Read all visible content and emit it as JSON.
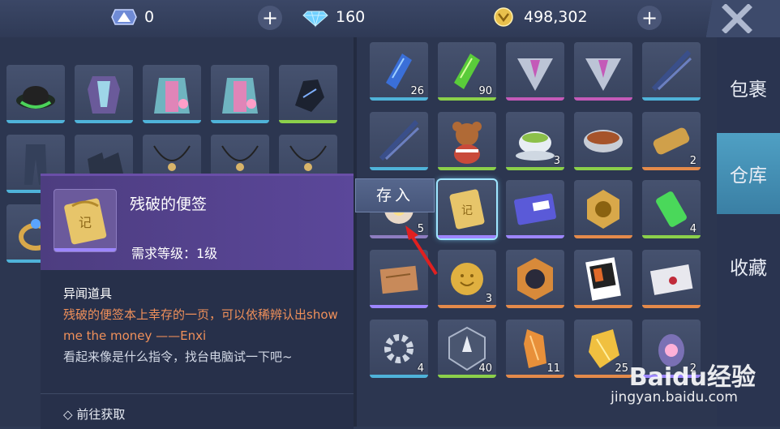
{
  "topbar": {
    "currency1": {
      "value": "0",
      "icon": "triangle-token-icon"
    },
    "currency2": {
      "value": "160",
      "icon": "diamond-icon"
    },
    "currency3": {
      "value": "498,302",
      "icon": "gold-coin-icon"
    },
    "close_icon": "close-icon"
  },
  "tabs": [
    {
      "label": "包裹"
    },
    {
      "label": "仓库"
    },
    {
      "label": "收藏"
    }
  ],
  "left_slots": [
    {
      "icon": "hat-icon",
      "bar": "#4fb3d9",
      "count": ""
    },
    {
      "icon": "armor-icon",
      "bar": "#4fb3d9",
      "count": ""
    },
    {
      "icon": "robe-icon",
      "bar": "#4fb3d9",
      "count": ""
    },
    {
      "icon": "robe-icon",
      "bar": "#4fb3d9",
      "count": ""
    },
    {
      "icon": "glove-icon",
      "bar": "#8bd04a",
      "count": ""
    },
    {
      "icon": "pants-icon",
      "bar": "#4fb3d9",
      "count": ""
    },
    {
      "icon": "boots-icon",
      "bar": "#4fb3d9",
      "count": ""
    },
    {
      "icon": "necklace-icon",
      "bar": "#4fb3d9",
      "count": ""
    },
    {
      "icon": "necklace-icon",
      "bar": "#4fb3d9",
      "count": ""
    },
    {
      "icon": "necklace-icon",
      "bar": "#4fb3d9",
      "count": ""
    },
    {
      "icon": "ring-icon",
      "bar": "#4fb3d9",
      "count": ""
    }
  ],
  "right_slots": [
    {
      "icon": "blue-crystal-icon",
      "bar": "#4fb3d9",
      "count": "26"
    },
    {
      "icon": "green-crystal-icon",
      "bar": "#8bd04a",
      "count": "90"
    },
    {
      "icon": "emblem-icon",
      "bar": "#c45ab8",
      "count": ""
    },
    {
      "icon": "emblem-icon",
      "bar": "#c45ab8",
      "count": ""
    },
    {
      "icon": "blade-icon",
      "bar": "#4fb3d9",
      "count": ""
    },
    {
      "icon": "blade-icon",
      "bar": "#4fb3d9",
      "count": ""
    },
    {
      "icon": "teddy-bear-icon",
      "bar": "#8bd04a",
      "count": ""
    },
    {
      "icon": "tea-cup-icon",
      "bar": "#8bd04a",
      "count": "3"
    },
    {
      "icon": "soup-bowl-icon",
      "bar": "#8bd04a",
      "count": ""
    },
    {
      "icon": "scroll-icon",
      "bar": "#e48a4a",
      "count": "2"
    },
    {
      "icon": "orb-icon",
      "bar": "#8d7dc0",
      "count": "5"
    },
    {
      "icon": "note-icon",
      "bar": "#9d86ff",
      "count": ""
    },
    {
      "icon": "game-card-icon",
      "bar": "#9d86ff",
      "count": ""
    },
    {
      "icon": "gold-hexagon-icon",
      "bar": "#e48a4a",
      "count": ""
    },
    {
      "icon": "green-vial-icon",
      "bar": "#8bd04a",
      "count": "4"
    },
    {
      "icon": "map-icon",
      "bar": "#9d86ff",
      "count": ""
    },
    {
      "icon": "smiley-coin-icon",
      "bar": "#e48a4a",
      "count": "3"
    },
    {
      "icon": "badge-icon",
      "bar": "#e48a4a",
      "count": ""
    },
    {
      "icon": "poster-icon",
      "bar": "#e48a4a",
      "count": ""
    },
    {
      "icon": "envelope-icon",
      "bar": "#e48a4a",
      "count": ""
    },
    {
      "icon": "gear-icon",
      "bar": "#4fb3d9",
      "count": "4"
    },
    {
      "icon": "shield-crest-icon",
      "bar": "#8bd04a",
      "count": "40"
    },
    {
      "icon": "amber-shard-icon",
      "bar": "#e48a4a",
      "count": "11"
    },
    {
      "icon": "gold-shard-icon",
      "bar": "#e48a4a",
      "count": "25"
    },
    {
      "icon": "lantern-icon",
      "bar": "#9d86ff",
      "count": "2"
    }
  ],
  "tooltip": {
    "name": "残破的便签",
    "level": "需求等级：1级",
    "type": "异闻道具",
    "desc_highlight": "残破的便签本上幸存的一页，可以依稀辨认出show me the money ——Enxi",
    "desc_normal": "看起来像是什么指令，找台电脑试一下吧~",
    "source_link": "前往获取",
    "icon": "note-icon"
  },
  "deposit_button": {
    "label": "存入"
  },
  "watermark": {
    "brand": "Baidu经验",
    "url": "jingyan.baidu.com"
  }
}
